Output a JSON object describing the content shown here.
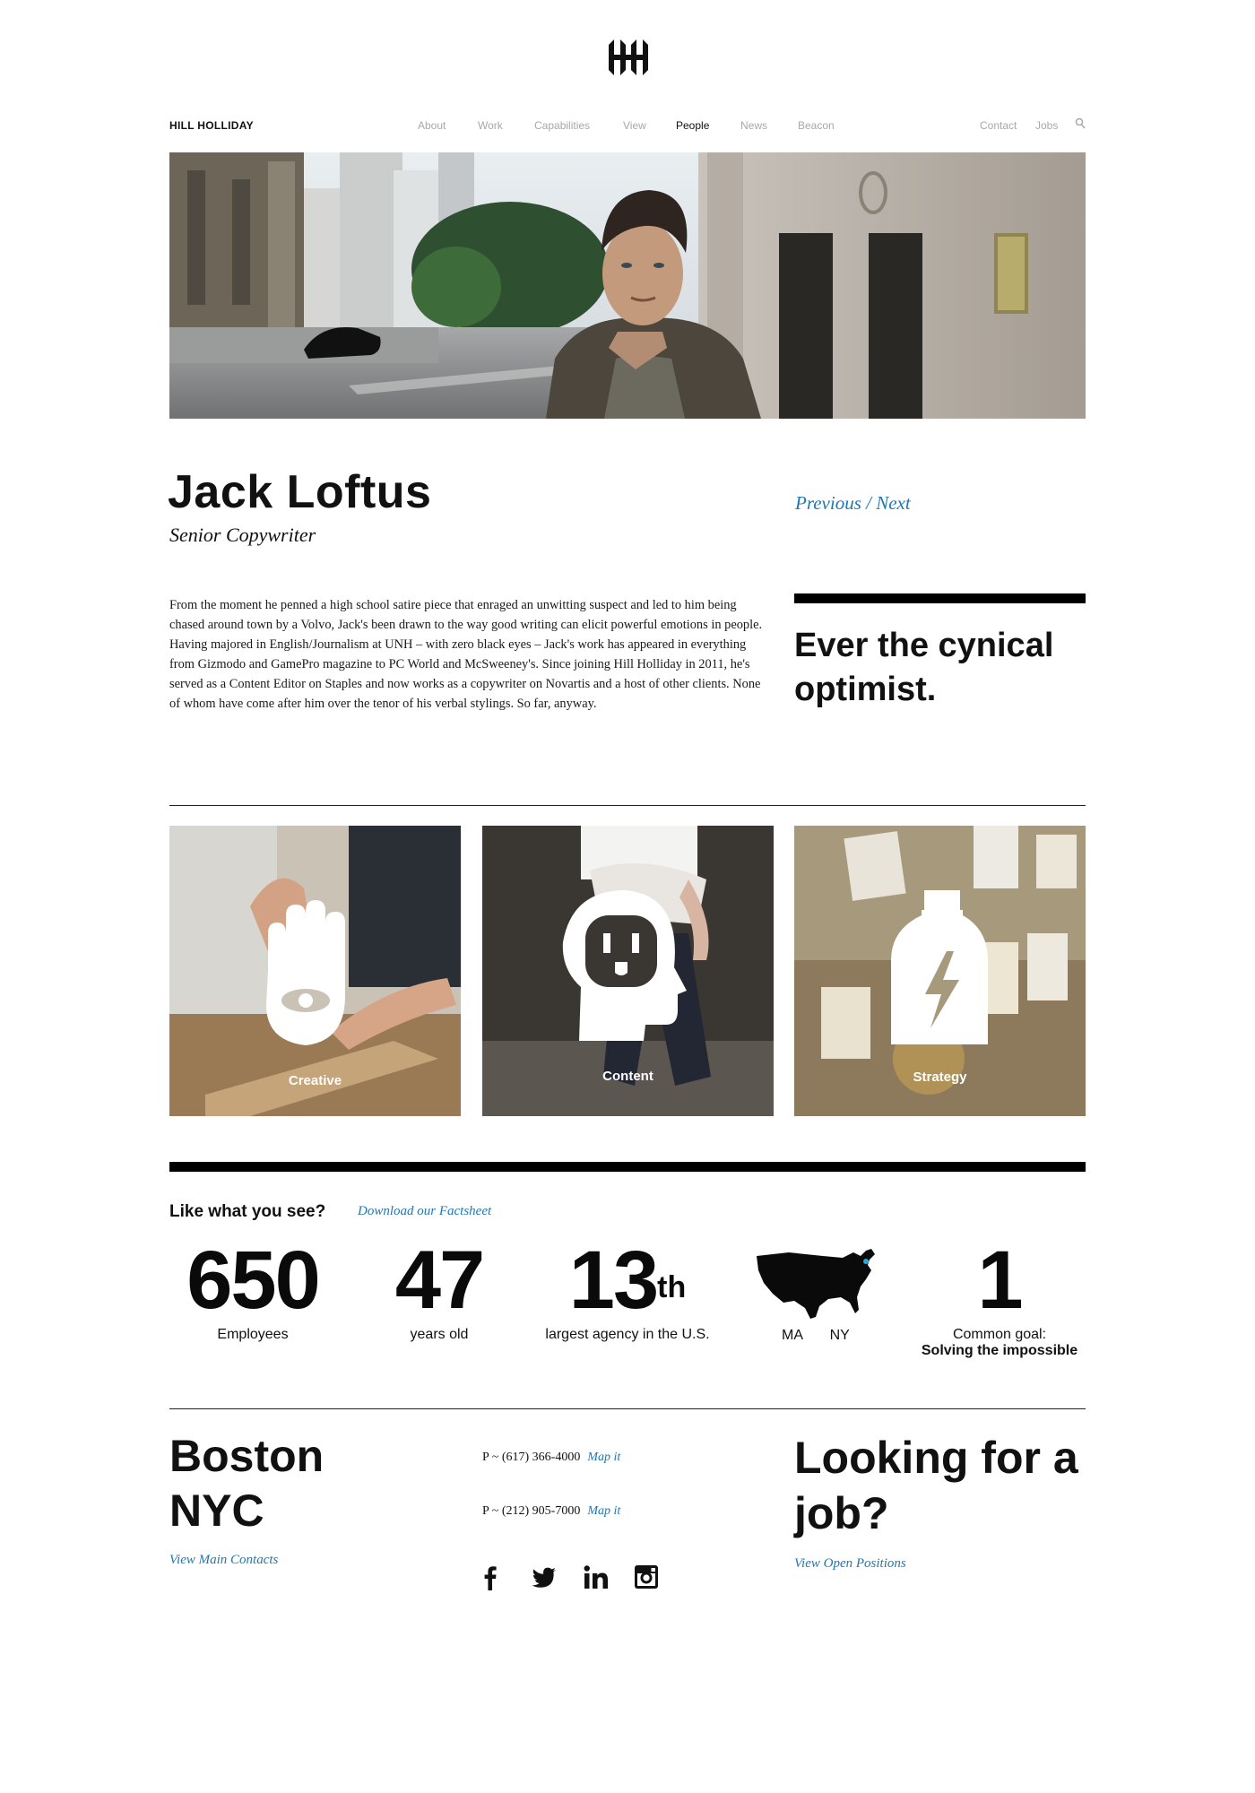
{
  "header": {
    "logo_icon": "hh-monogram-logo",
    "brand": "HILL HOLLIDAY",
    "nav": [
      {
        "label": "About",
        "active": false
      },
      {
        "label": "Work",
        "active": false
      },
      {
        "label": "Capabilities",
        "active": false
      },
      {
        "label": "View",
        "active": false
      },
      {
        "label": "People",
        "active": true
      },
      {
        "label": "News",
        "active": false
      },
      {
        "label": "Beacon",
        "active": false
      }
    ],
    "utility": [
      {
        "label": "Contact"
      },
      {
        "label": "Jobs"
      }
    ],
    "search_icon": "search-icon"
  },
  "profile": {
    "name": "Jack Loftus",
    "title": "Senior Copywriter",
    "previous": "Previous",
    "separator": " / ",
    "next": "Next",
    "bio": "From the moment he penned a high school satire piece that enraged an unwitting suspect and led to him being chased around town by a Volvo, Jack's been drawn to the way good writing can elicit powerful emotions in people. Having majored in English/Journalism at UNH – with zero black eyes – Jack's work has appeared in everything from Gizmodo and GamePro magazine to PC World and McSweeney's. Since joining Hill Holliday in 2011, he's served as a Content Editor on Staples and now works as a copywriter on Novartis and a host of other clients. None of whom have come after him over the tenor of his verbal stylings. So far, anyway.",
    "quote": "Ever the cynical optimist."
  },
  "capabilities": [
    {
      "label": "Creative",
      "icon": "hand-eye-icon"
    },
    {
      "label": "Content",
      "icon": "outlet-head-icon"
    },
    {
      "label": "Strategy",
      "icon": "lightning-bottle-icon"
    }
  ],
  "facts": {
    "title": "Like what you see?",
    "download": "Download our Factsheet",
    "employees": {
      "num": "650",
      "label": "Employees"
    },
    "age": {
      "num": "47",
      "label": "years old"
    },
    "rank": {
      "num": "13",
      "sup": "th",
      "label": "largest agency in the U.S."
    },
    "locations": {
      "icon": "usa-map-icon",
      "a": "MA",
      "b": "NY"
    },
    "goal": {
      "num": "1",
      "label": "Common goal:",
      "label_bold": "Solving the impossible"
    }
  },
  "footer": {
    "city1": "Boston",
    "city2": "NYC",
    "contacts_link": "View Main Contacts",
    "phone1": "P ~ (617) 366-4000",
    "phone2": "P ~ (212) 905-7000",
    "map_it": "Map it",
    "jobs_title": "Looking for a job?",
    "jobs_link": "View Open Positions",
    "social": [
      "facebook-icon",
      "twitter-icon",
      "linkedin-icon",
      "instagram-icon"
    ]
  },
  "colors": {
    "accent_link": "#1f77b4",
    "nav_inactive": "#a8a8a8",
    "text": "#111111"
  }
}
